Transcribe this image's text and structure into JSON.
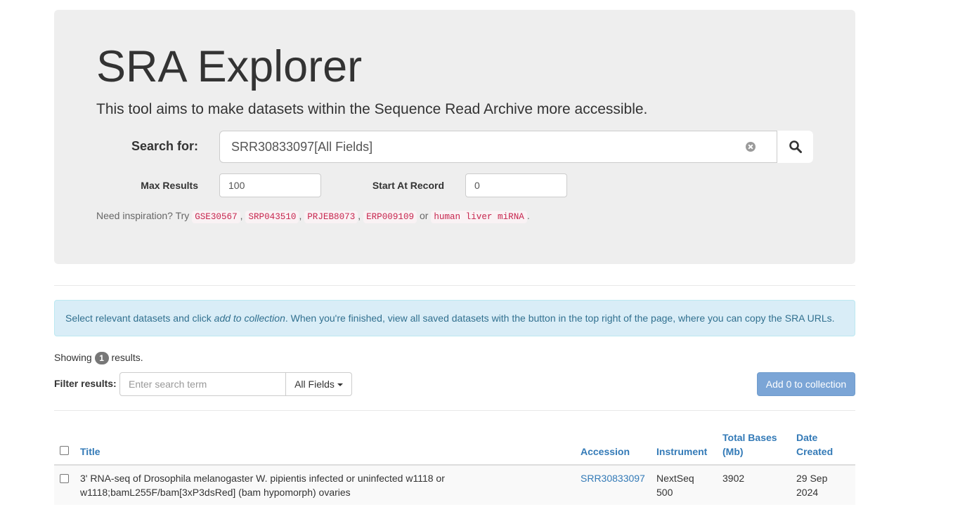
{
  "header": {
    "title": "SRA Explorer",
    "subtitle": "This tool aims to make datasets within the Sequence Read Archive more accessible."
  },
  "search": {
    "label": "Search for:",
    "value": "SRR30833097[All Fields]",
    "max_results_label": "Max Results",
    "max_results_value": "100",
    "start_label": "Start At Record",
    "start_value": "0"
  },
  "inspiration": {
    "prefix": "Need inspiration? Try",
    "examples": [
      "GSE30567",
      "SRP043510",
      "PRJEB8073",
      "ERP009109"
    ],
    "or_text": "or",
    "last_example": "human liver miRNA",
    "separator": ",",
    "period": "."
  },
  "info": {
    "part1": "Select relevant datasets and click ",
    "emphasis": "add to collection",
    "part2": ". When you're finished, view all saved datasets with the button in the top right of the page, where you can copy the SRA URLs."
  },
  "results": {
    "showing_prefix": "Showing",
    "count": "1",
    "showing_suffix": "results.",
    "filter_label": "Filter results:",
    "filter_placeholder": "Enter search term",
    "filter_field": "All Fields",
    "add_button": "Add 0 to collection"
  },
  "table": {
    "columns": {
      "title": "Title",
      "accession": "Accession",
      "instrument": "Instrument",
      "total_bases_1": "Total Bases",
      "total_bases_2": "(Mb)",
      "date_1": "Date",
      "date_2": "Created"
    },
    "rows": [
      {
        "title_1": "3' RNA-seq of Drosophila melanogaster W. pipientis infected or uninfected w1118 or",
        "title_2": "w1118;bamL255F/bam[3xP3dsRed] (bam hypomorph) ovaries",
        "accession": "SRR30833097",
        "instrument_1": "NextSeq",
        "instrument_2": "500",
        "total_bases": "3902",
        "date_1": "29 Sep",
        "date_2": "2024"
      }
    ]
  }
}
